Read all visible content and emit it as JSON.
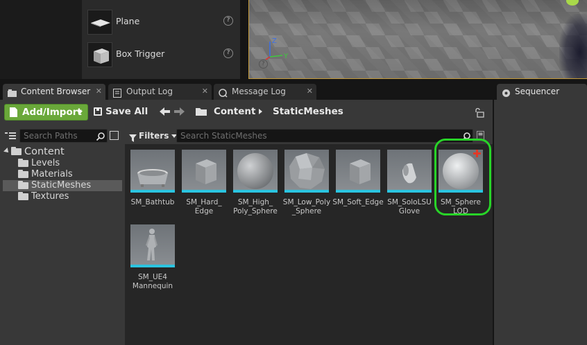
{
  "place_panel": {
    "items": [
      {
        "label": "Plane",
        "help": "?"
      },
      {
        "label": "Box Trigger",
        "help": "?"
      }
    ]
  },
  "viewport": {
    "axis_z": "Z",
    "axis_y": "Y",
    "help": "?"
  },
  "tabs": [
    {
      "label": "Content Browser",
      "icon": "content-browser-icon",
      "close": "✕"
    },
    {
      "label": "Output Log",
      "icon": "output-log-icon",
      "close": "✕"
    },
    {
      "label": "Message Log",
      "icon": "message-log-icon",
      "close": "✕"
    },
    {
      "label": "Sequencer",
      "icon": "sequencer-icon"
    }
  ],
  "toolbar": {
    "add_import": "Add/Import",
    "save_all": "Save All",
    "back": "🡠",
    "forward": "🡢",
    "breadcrumb": [
      "Content",
      "StaticMeshes"
    ]
  },
  "sources": {
    "search_placeholder": "Search Paths",
    "tree": [
      {
        "label": "Content",
        "level": 0
      },
      {
        "label": "Levels",
        "level": 1
      },
      {
        "label": "Materials",
        "level": 1
      },
      {
        "label": "StaticMeshes",
        "level": 1,
        "selected": true
      },
      {
        "label": "Textures",
        "level": 1
      }
    ]
  },
  "assets": {
    "filters_label": "Filters",
    "search_placeholder": "Search StaticMeshes",
    "items": [
      {
        "name": "SM_Bathtub",
        "icon": "bathtub-mesh-icon"
      },
      {
        "name": "SM_Hard_\nEdge",
        "icon": "cube-mesh-icon"
      },
      {
        "name": "SM_High_\nPoly_Sphere",
        "icon": "sphere-mesh-icon"
      },
      {
        "name": "SM_Low_Poly\n_Sphere",
        "icon": "low-poly-sphere-mesh-icon"
      },
      {
        "name": "SM_Soft_Edge",
        "icon": "cube-mesh-icon"
      },
      {
        "name": "SM_SoloLSU\nGlove",
        "icon": "glove-mesh-icon"
      },
      {
        "name": "SM_Sphere\nLOD",
        "icon": "sphere-mesh-icon",
        "highlighted": true,
        "badge": "plus-icon"
      },
      {
        "name": "SM_UE4\nMannequin",
        "icon": "mannequin-mesh-icon"
      }
    ]
  },
  "colors": {
    "accent_green": "#6aa83a",
    "asset_bar": "#2bc4e0",
    "highlight": "#28d428",
    "viewport_border": "#c49a3a"
  }
}
